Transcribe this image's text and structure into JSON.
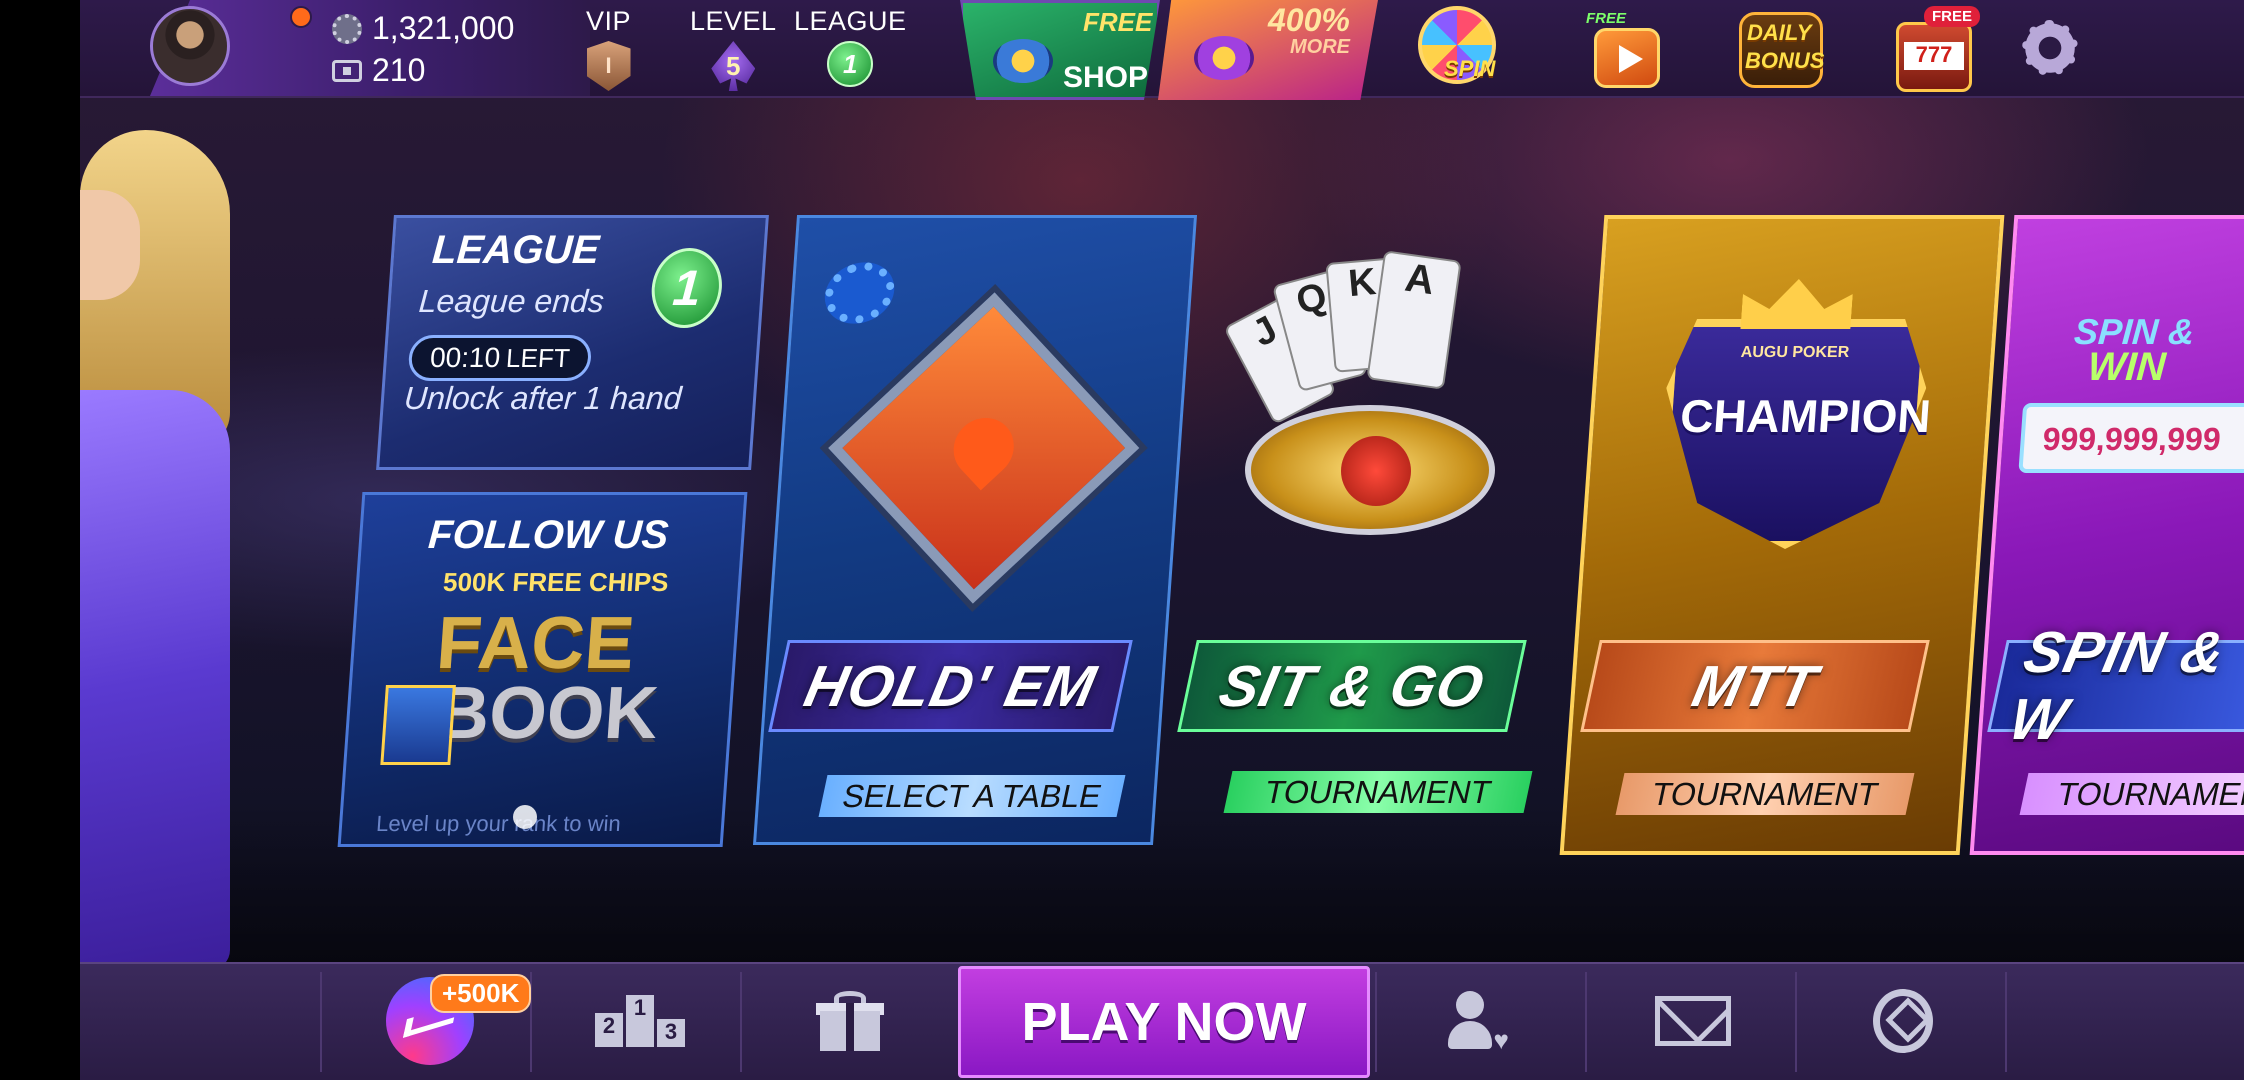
{
  "profile": {
    "chips": "1,321,000",
    "tickets": "210"
  },
  "badges": {
    "vip_label": "VIP",
    "vip_value": "I",
    "level_label": "LEVEL",
    "level_value": "5",
    "league_label": "LEAGUE",
    "league_value": "1"
  },
  "shop": {
    "free_label": "FREE",
    "shop_label": "SHOP",
    "promo_percent": "400%",
    "promo_more": "MORE"
  },
  "top_icons": {
    "spin_label": "SPIN",
    "free_video_label": "FREE",
    "daily_bonus_line1": "DAILY",
    "daily_bonus_line2": "BONUS",
    "slots_free_label": "FREE",
    "slots_reels": "777"
  },
  "league_card": {
    "title": "LEAGUE",
    "ends_text": "League ends",
    "timer": "00:10",
    "timer_suffix": "LEFT",
    "unlock_text": "Unlock after 1 hand",
    "badge_number": "1"
  },
  "follow_card": {
    "title": "FOLLOW US",
    "subtitle": "500K FREE CHIPS",
    "brand_line1": "FACE",
    "brand_line2": "BOOK",
    "footer": "Level up your rank to win"
  },
  "game_cards": [
    {
      "title": "HOLD' EM",
      "subtitle": "SELECT A TABLE"
    },
    {
      "title": "SIT & GO",
      "subtitle": "TOURNAMENT",
      "card_letters": [
        "J",
        "Q",
        "K",
        "A"
      ]
    },
    {
      "title": "MTT",
      "subtitle": "TOURNAMENT",
      "emblem_top": "AUGU POKER",
      "emblem": "CHAMPION"
    },
    {
      "title": "SPIN & W",
      "subtitle": "TOURNAMEN",
      "logo_line1": "SPIN &",
      "logo_line2": "WIN",
      "prize": "999,999,999"
    }
  ],
  "bottom_nav": {
    "messenger_badge": "+500K",
    "podium_numbers": [
      "2",
      "1",
      "3"
    ],
    "play_now": "PLAY NOW"
  },
  "colors": {
    "play_now": "#9a22d0",
    "holdem_card": "#1f4fa8",
    "mtt_card": "#d8a020",
    "spinwin_card": "#c040e0",
    "sitgo_banner": "#1f9a4a"
  }
}
